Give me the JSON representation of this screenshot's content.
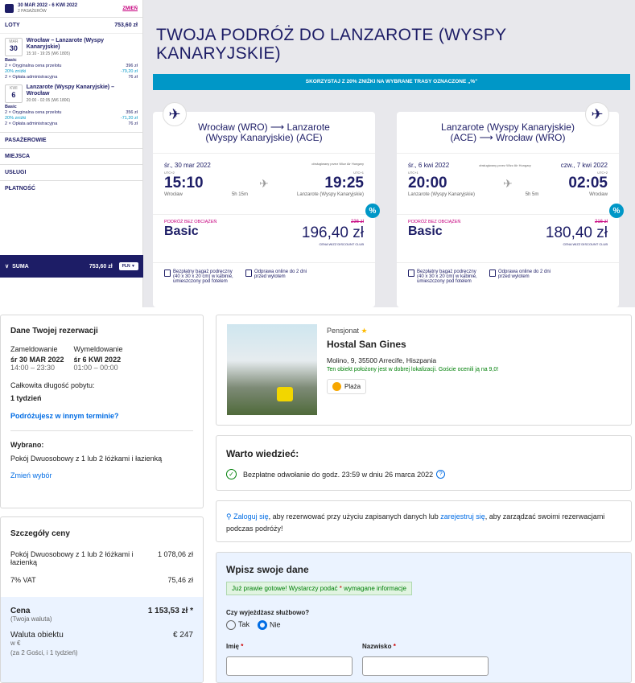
{
  "top": {
    "header": {
      "dates": "30 MAR 2022 - 6 KWI 2022",
      "passengers": "2 PASAŻERÓW",
      "change": "ZMIEŃ"
    },
    "flights_label": "LOTY",
    "flights_total": "753,60 zł",
    "f1": {
      "mon": "MAR",
      "day": "30",
      "route": "Wrocław – Lanzarote (Wyspy Kanaryjskie)",
      "time": "15:10 - 19:25 (W6 1805)"
    },
    "f1p": [
      [
        "Basic",
        ""
      ],
      [
        "2 × Oryginalna cena przelotu",
        "396 zł"
      ],
      [
        "20% zniżki",
        "-79,20 zł"
      ],
      [
        "2 × Opłata administracyjna",
        "76 zł"
      ]
    ],
    "f2": {
      "mon": "KWI",
      "day": "6",
      "route": "Lanzarote (Wyspy Kanaryjskie) – Wrocław",
      "time": "20:00 - 02:05 (W6 1806)"
    },
    "f2p": [
      [
        "Basic",
        ""
      ],
      [
        "2 × Oryginalna cena przelotu",
        "356 zł"
      ],
      [
        "20% zniżki",
        "-71,20 zł"
      ],
      [
        "2 × Opłata administracyjna",
        "76 zł"
      ]
    ],
    "sections": [
      "PASAŻEROWIE",
      "MIEJSCA",
      "USŁUGI",
      "PŁATNOŚĆ"
    ],
    "suma": "SUMA",
    "suma_val": "753,60 zł",
    "currency": "PLN",
    "title": "TWOJA PODRÓŻ DO LANZAROTE (WYSPY KANARYJSKIE)",
    "banner": "SKORZYSTAJ Z 20% ZNIŻKI NA WYBRANE TRASY OZNACZONE „%\"",
    "c1": {
      "head": "Wrocław (WRO) ⟶ Lanzarote (Wyspy Kanaryjskie) (ACE)",
      "date": "śr., 30 mar 2022",
      "op": "obsługiwany przez Wizz Air Hungary",
      "t1": "15:10",
      "t2": "19:25",
      "tz1": "UTC+2",
      "tz2": "UTC+1",
      "dur": "5h 15m",
      "from": "Wrocław",
      "to": "Lanzarote (Wyspy Kanaryjskie)",
      "bag": "PODRÓŻ BEZ OBCIĄŻEŃ",
      "fare": "Basic",
      "old": "236 zł",
      "price": "196,40 zł",
      "club": "CENA WIZZ DISCOUNT CLUB"
    },
    "c2": {
      "head": "Lanzarote (Wyspy Kanaryjskie) (ACE) ⟶ Wrocław (WRO)",
      "date": "śr., 6 kwi 2022",
      "op": "obsługiwany przez Wizz Air Hungary",
      "date2": "czw., 7 kwi 2022",
      "t1": "20:00",
      "t2": "02:05",
      "tz1": "UTC+1",
      "tz2": "UTC+2",
      "dur": "5h 5m",
      "from": "Lanzarote (Wyspy Kanaryjskie)",
      "to": "Wrocław",
      "bag": "PODRÓŻ BEZ OBCIĄŻEŃ",
      "fare": "Basic",
      "old": "216 zł",
      "price": "180,40 zł",
      "club": "CENA WIZZ DISCOUNT CLUB"
    },
    "feat1": "Bezpłatny bagaż podręczny (40 x 30 x 20 cm) w kabinie, umieszczony pod fotelem",
    "feat2": "Odprawa online do 2 dni przed wylotem"
  },
  "booking": {
    "title": "Dane Twojej rezerwacji",
    "checkin_l": "Zameldowanie",
    "checkout_l": "Wymeldowanie",
    "checkin": "śr 30 MAR 2022",
    "checkout": "śr 6 KWI 2022",
    "checkin_t": "14:00 – 23:30",
    "checkout_t": "01:00 – 00:00",
    "stay_l": "Całkowita długość pobytu:",
    "stay": "1 tydzień",
    "other": "Podróżujesz w innym terminie?",
    "sel_l": "Wybrano:",
    "sel": "Pokój Dwuosobowy z 1 lub 2 łóżkami i łazienką",
    "change": "Zmień wybór"
  },
  "price": {
    "title": "Szczegóły ceny",
    "room": "Pokój Dwuosobowy z 1 lub 2 łóżkami i łazienką",
    "room_v": "1 078,06 zł",
    "vat": "7% VAT",
    "vat_v": "75,46 zł",
    "cena": "Cena",
    "cena_v": "1 153,53 zł *",
    "cena_s": "(Twoja waluta)",
    "wal": "Waluta obiektu",
    "wal_v": "€ 247",
    "wal_s": "w €",
    "wal_n": "(za 2 Gości, i 1 tydzień)"
  },
  "hotel": {
    "type": "Pensjonat",
    "name": "Hostal San Gines",
    "addr": "Molino, 9, 35500 Arrecife, Hiszpania",
    "loc": "Ten obiekt położony jest w dobrej lokalizacji. Goście ocenili ją na 9,0!",
    "beach": "Plaża"
  },
  "know": {
    "title": "Warto wiedzieć:",
    "cancel": "Bezpłatne odwołanie do godz. 23:59 w dniu 26 marca 2022"
  },
  "login": {
    "a": "Zaloguj się",
    "b": ", aby rezerwować przy użyciu zapisanych danych lub ",
    "c": "zarejestruj się",
    "d": ", aby zarządzać swoimi rezerwacjami podczas podróży!"
  },
  "form": {
    "title": "Wpisz swoje dane",
    "ready_a": "Już prawie gotowe! Wystarczy podać ",
    "ready_b": " wymagane informacje",
    "biz": "Czy wyjeżdżasz służbowo?",
    "tak": "Tak",
    "nie": "Nie",
    "imie": "Imię",
    "nazwisko": "Nazwisko"
  }
}
